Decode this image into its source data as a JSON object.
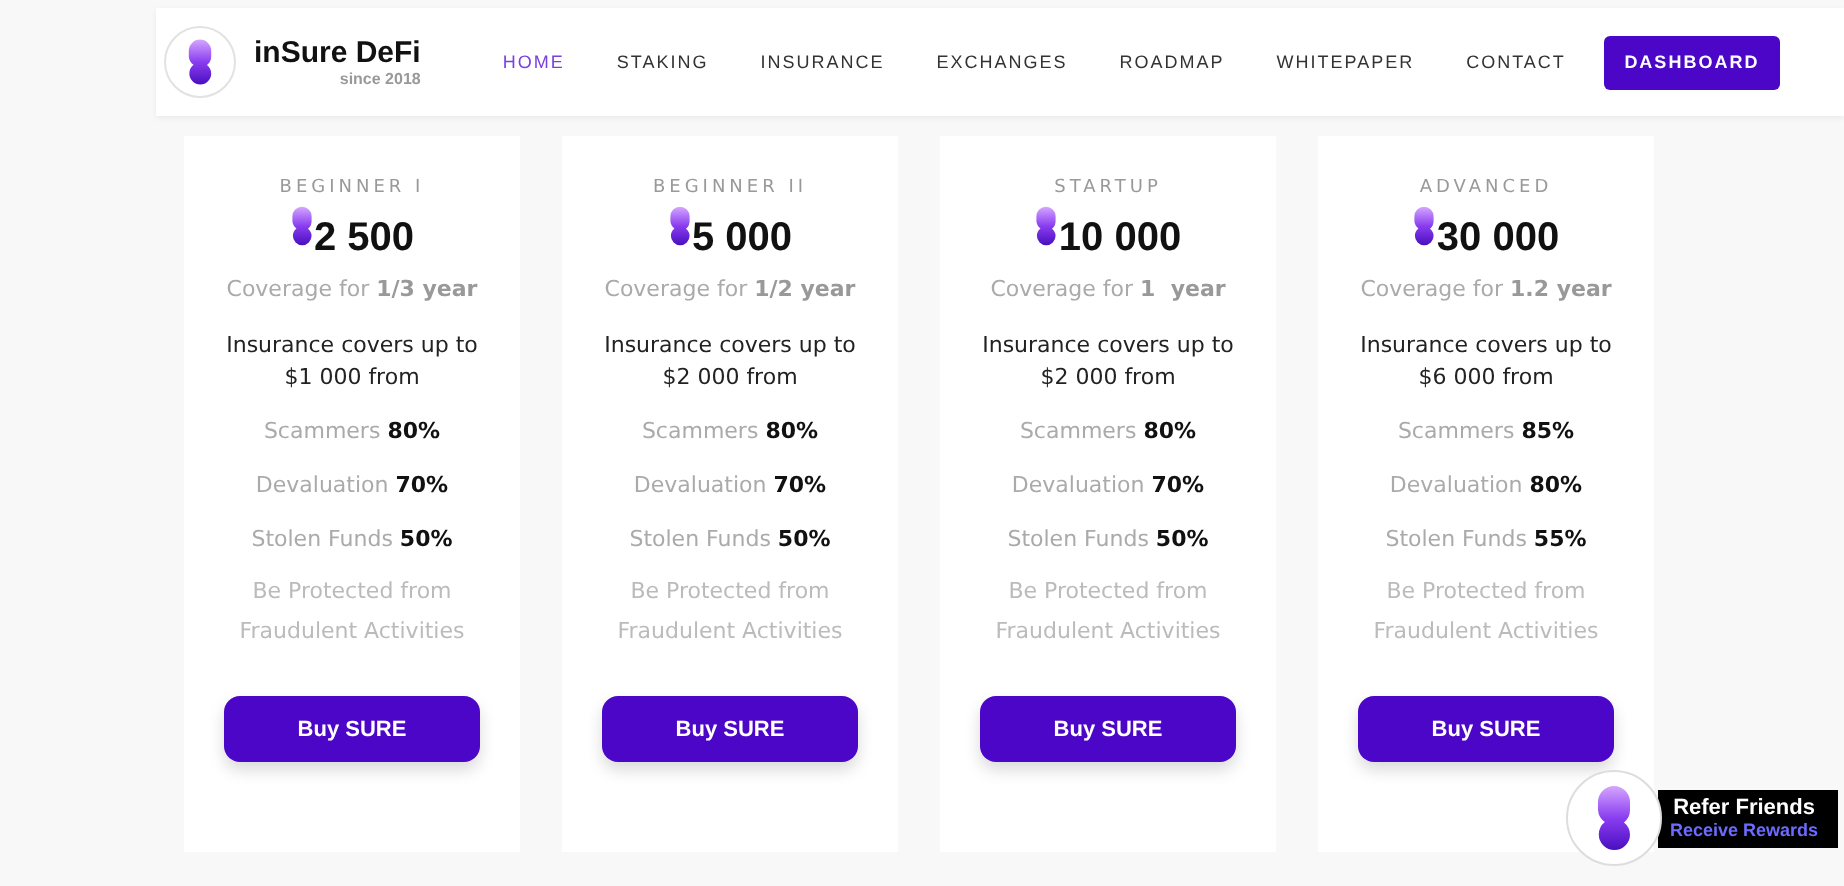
{
  "brand": {
    "name": "inSure DeFi",
    "tagline": "since 2018"
  },
  "nav": [
    {
      "label": "HOME",
      "selected": true
    },
    {
      "label": "STAKING",
      "selected": false
    },
    {
      "label": "INSURANCE",
      "selected": false
    },
    {
      "label": "EXCHANGES",
      "selected": false
    },
    {
      "label": "ROADMAP",
      "selected": false
    },
    {
      "label": "WHITEPAPER",
      "selected": false
    },
    {
      "label": "CONTACT",
      "selected": false
    }
  ],
  "nav_button": "DASHBOARD",
  "plans": [
    {
      "tier": "BEGINNER I",
      "amount": "2 500",
      "coverage": "Coverage for **1/3 year**",
      "covers": "Insurance covers up to $1 000 from",
      "risks": [
        "Scammers **80%**",
        "Devaluation **70%**",
        "Stolen Funds **50%**"
      ],
      "note": "Be Protected from Fraudulent Activities",
      "button": "Buy SURE"
    },
    {
      "tier": "BEGINNER II",
      "amount": "5 000",
      "coverage": "Coverage for **1/2 year**",
      "covers": "Insurance covers up to $2 000 from",
      "risks": [
        "Scammers **80%**",
        "Devaluation **70%**",
        "Stolen Funds **50%**"
      ],
      "note": "Be Protected from Fraudulent Activities",
      "button": "Buy SURE"
    },
    {
      "tier": "STARTUP",
      "amount": "10 000",
      "coverage": "Coverage for **1  year**",
      "covers": "Insurance covers up to $2 000 from",
      "risks": [
        "Scammers **80%**",
        "Devaluation **70%**",
        "Stolen Funds **50%**"
      ],
      "note": "Be Protected from Fraudulent Activities",
      "button": "Buy SURE"
    },
    {
      "tier": "ADVANCED",
      "amount": "30 000",
      "coverage": "Coverage for **1.2 year**",
      "covers": "Insurance covers up to $6 000 from",
      "risks": [
        "Scammers **85%**",
        "Devaluation **80%**",
        "Stolen Funds **55%**"
      ],
      "note": "Be Protected from Fraudulent Activities",
      "button": "Buy SURE"
    }
  ],
  "refer": {
    "title": "Refer Friends",
    "subtitle": "Receive Rewards"
  }
}
